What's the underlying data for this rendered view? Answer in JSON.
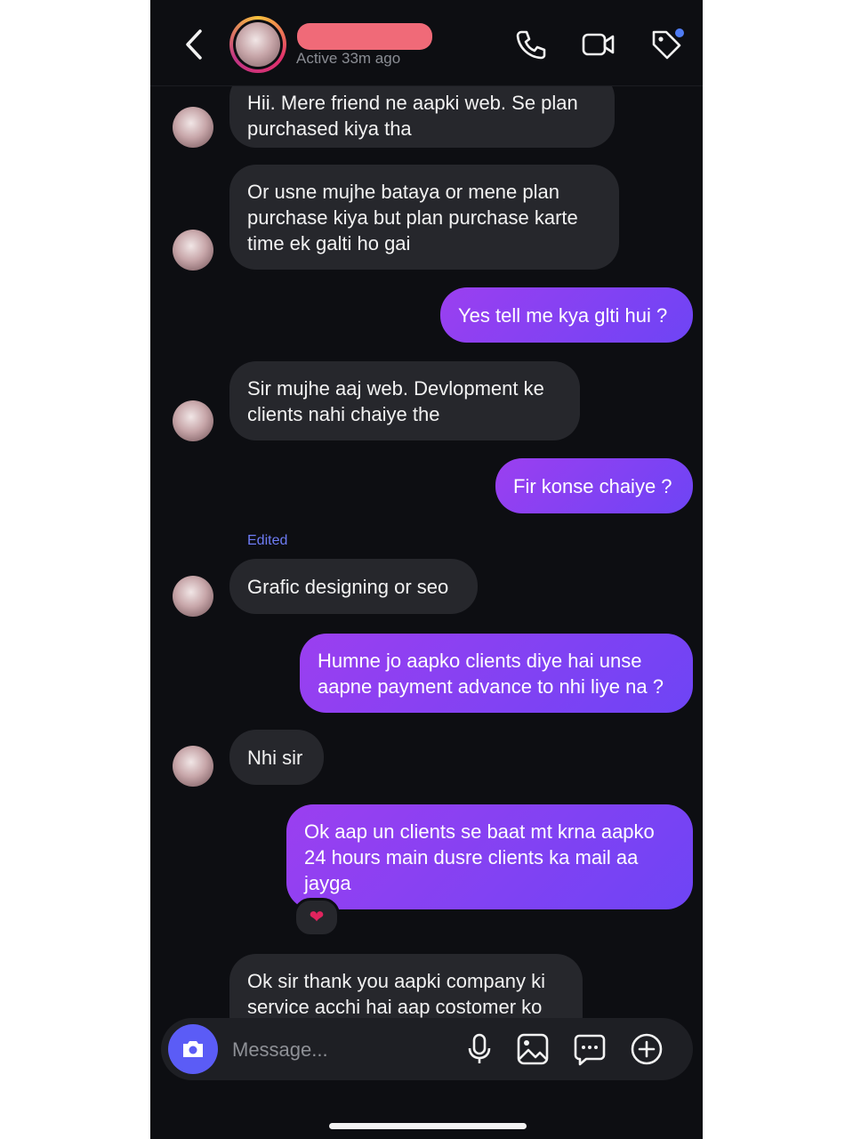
{
  "header": {
    "status": "Active 33m ago"
  },
  "messages": [
    {
      "text": "Hii. Mere friend ne aapki web. Se plan\npurchased kiya tha"
    },
    {
      "text": "Or usne mujhe bataya or mene plan\npurchase kiya but plan purchase karte\ntime ek galti ho gai"
    },
    {
      "text": "Yes tell me kya glti hui ?"
    },
    {
      "text": "Sir mujhe aaj web. Devlopment ke\nclients nahi chaiye the"
    },
    {
      "text": "Fir konse chaiye ?"
    },
    {
      "text": "Grafic designing or seo"
    },
    {
      "text": "Humne jo aapko clients diye hai unse\naapne payment advance to nhi liye na ?"
    },
    {
      "text": "Nhi sir"
    },
    {
      "text": "Ok aap un clients se baat mt krna aapko\n24 hours main dusre clients ka mail aa\njayga"
    },
    {
      "text": "Ok sir thank you aapki company ki\nservice acchi hai aap costomer ko"
    }
  ],
  "edited_label": "Edited",
  "reaction": "❤",
  "composer": {
    "placeholder": "Message..."
  },
  "colors": {
    "background": "#0d0e12",
    "incoming_bubble": "#26272c",
    "outgoing_bubble": "#7b42f4",
    "accent": "#5b5cf6"
  },
  "icons": [
    "back-icon",
    "phone-icon",
    "video-icon",
    "tag-icon",
    "camera-icon",
    "mic-icon",
    "gallery-icon",
    "sticker-icon",
    "plus-icon"
  ]
}
